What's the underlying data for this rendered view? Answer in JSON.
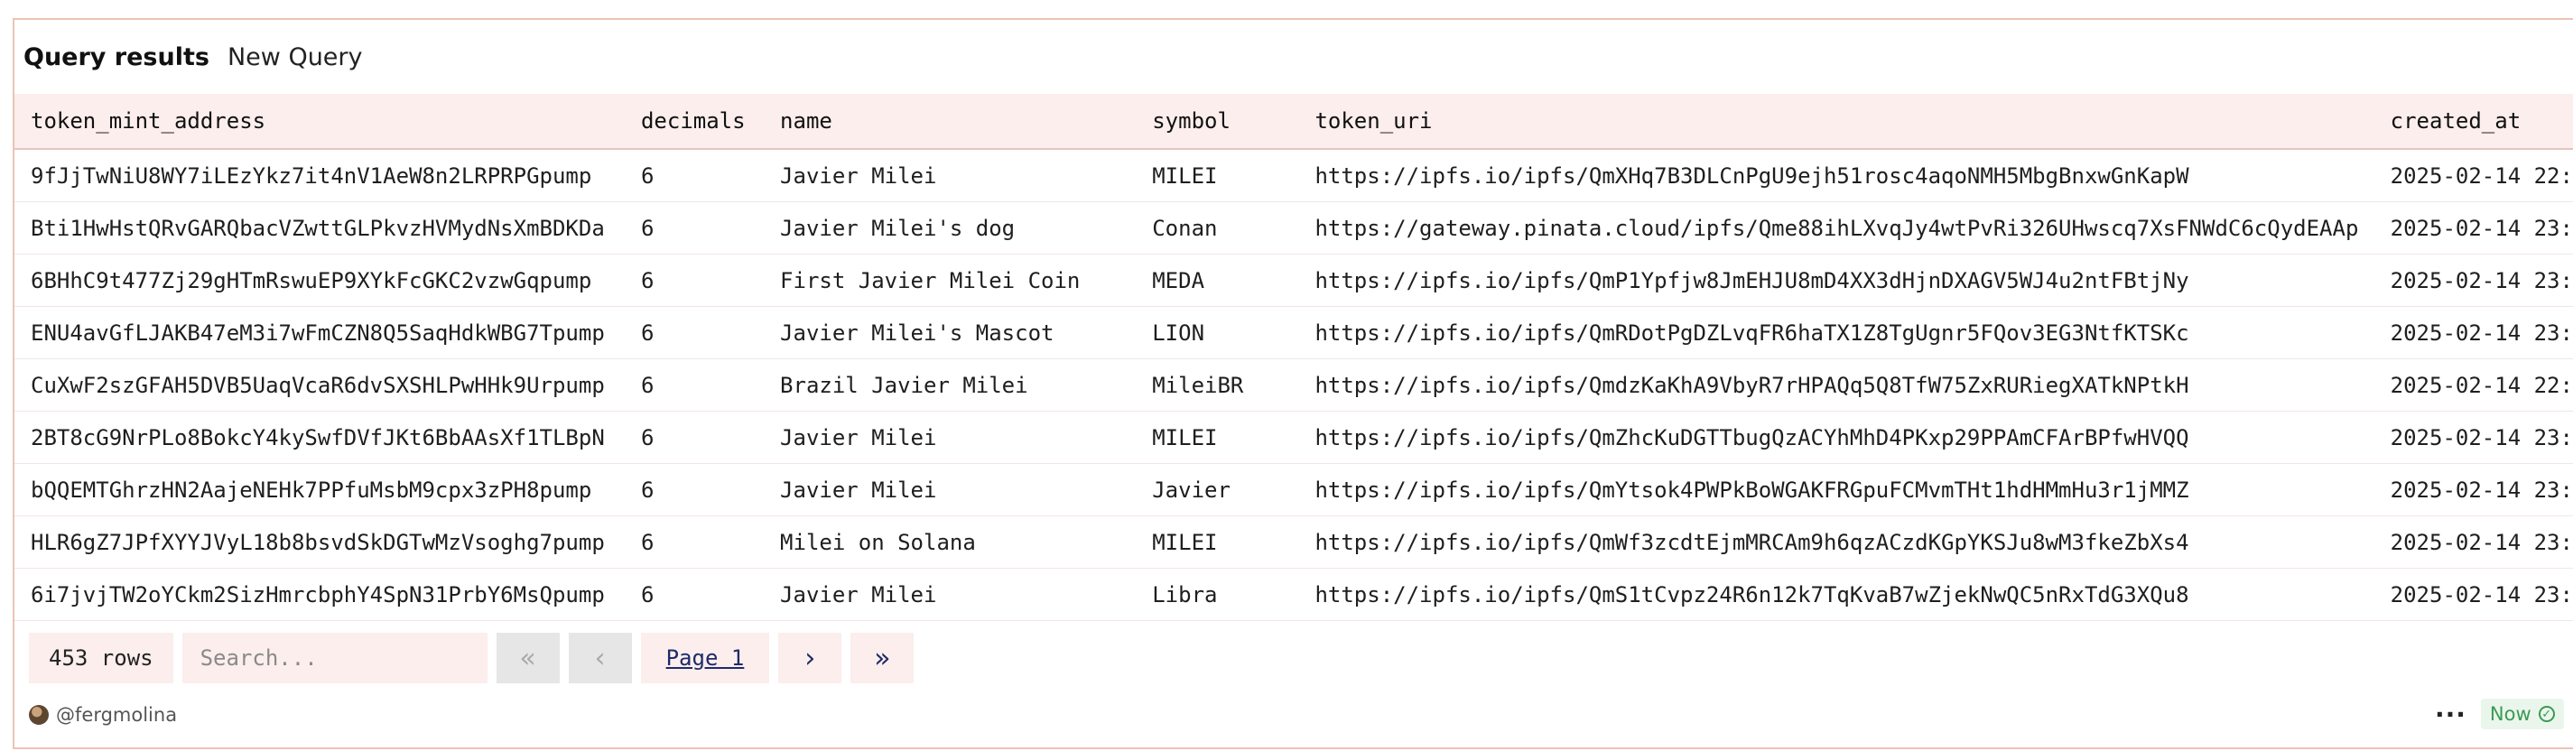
{
  "tabs": {
    "active": "Query results",
    "other": "New Query"
  },
  "table": {
    "columns": [
      "token_mint_address",
      "decimals",
      "name",
      "symbol",
      "token_uri",
      "created_at"
    ],
    "rows": [
      [
        "9fJjTwNiU8WY7iLEzYkz7it4nV1AeW8n2LRPRPGpump",
        "6",
        "Javier Milei",
        "MILEI",
        "https://ipfs.io/ipfs/QmXHq7B3DLCnPgU9ejh51rosc4aqoNMH5MbgBnxwGnKapW",
        "2025-02-14 22:"
      ],
      [
        "Bti1HwHstQRvGARQbacVZwttGLPkvzHVMydNsXmBDKDa",
        "6",
        "Javier Milei's dog",
        "Conan",
        "https://gateway.pinata.cloud/ipfs/Qme88ihLXvqJy4wtPvRi326UHwscq7XsFNWdC6cQydEAAp",
        "2025-02-14 23:"
      ],
      [
        "6BHhC9t477Zj29gHTmRswuEP9XYkFcGKC2vzwGqpump",
        "6",
        "First Javier Milei Coin",
        "MEDA",
        "https://ipfs.io/ipfs/QmP1Ypfjw8JmEHJU8mD4XX3dHjnDXAGV5WJ4u2ntFBtjNy",
        "2025-02-14 23:"
      ],
      [
        "ENU4avGfLJAKB47eM3i7wFmCZN8Q5SaqHdkWBG7Tpump",
        "6",
        "Javier Milei's Mascot",
        "LION",
        "https://ipfs.io/ipfs/QmRDotPgDZLvqFR6haTX1Z8TgUgnr5FQov3EG3NtfKTSKc",
        "2025-02-14 23:"
      ],
      [
        "CuXwF2szGFAH5DVB5UaqVcaR6dvSXSHLPwHHk9Urpump",
        "6",
        "Brazil Javier Milei",
        "MileiBR",
        "https://ipfs.io/ipfs/QmdzKaKhA9VbyR7rHPAQq5Q8TfW75ZxRURiegXATkNPtkH",
        "2025-02-14 22:"
      ],
      [
        "2BT8cG9NrPLo8BokcY4kySwfDVfJKt6BbAAsXf1TLBpN",
        "6",
        "Javier Milei",
        "MILEI",
        "https://ipfs.io/ipfs/QmZhcKuDGTTbugQzACYhMhD4PKxp29PPAmCFArBPfwHVQQ",
        "2025-02-14 23:"
      ],
      [
        "bQQEMTGhrzHN2AajeNEHk7PPfuMsbM9cpx3zPH8pump",
        "6",
        "Javier Milei",
        "Javier",
        "https://ipfs.io/ipfs/QmYtsok4PWPkBoWGAKFRGpuFCMvmTHt1hdHMmHu3r1jMMZ",
        "2025-02-14 23:"
      ],
      [
        "HLR6gZ7JPfXYYJVyL18b8bsvdSkDGTwMzVsoghg7pump",
        "6",
        "Milei on Solana",
        "MILEI",
        "https://ipfs.io/ipfs/QmWf3zcdtEjmMRCAm9h6qzACzdKGpYKSJu8wM3fkeZbXs4",
        "2025-02-14 23:"
      ],
      [
        "6i7jvjTW2oYCkm2SizHmrcbphY4SpN31PrbY6MsQpump",
        "6",
        "Javier Milei",
        "Libra",
        "https://ipfs.io/ipfs/QmS1tCvpz24R6n12k7TqKvaB7wZjekNwQC5nRxTdG3XQu8",
        "2025-02-14 23:"
      ]
    ]
  },
  "pager": {
    "rows_label": "453 rows",
    "search_placeholder": "Search...",
    "page_label": "Page 1",
    "icons": [
      "double-chevron-left-icon",
      "chevron-left-icon",
      "chevron-right-icon",
      "double-chevron-right-icon"
    ]
  },
  "footer": {
    "author": "@fergmolina",
    "more_icon": "more-horizontal-icon",
    "status": "Now",
    "status_icon": "check-circle-icon",
    "status_color": "#3b9a55"
  },
  "colors": {
    "accent_bg": "#fbeeec",
    "border": "#ecc3b5",
    "link": "#1f2a6b"
  }
}
